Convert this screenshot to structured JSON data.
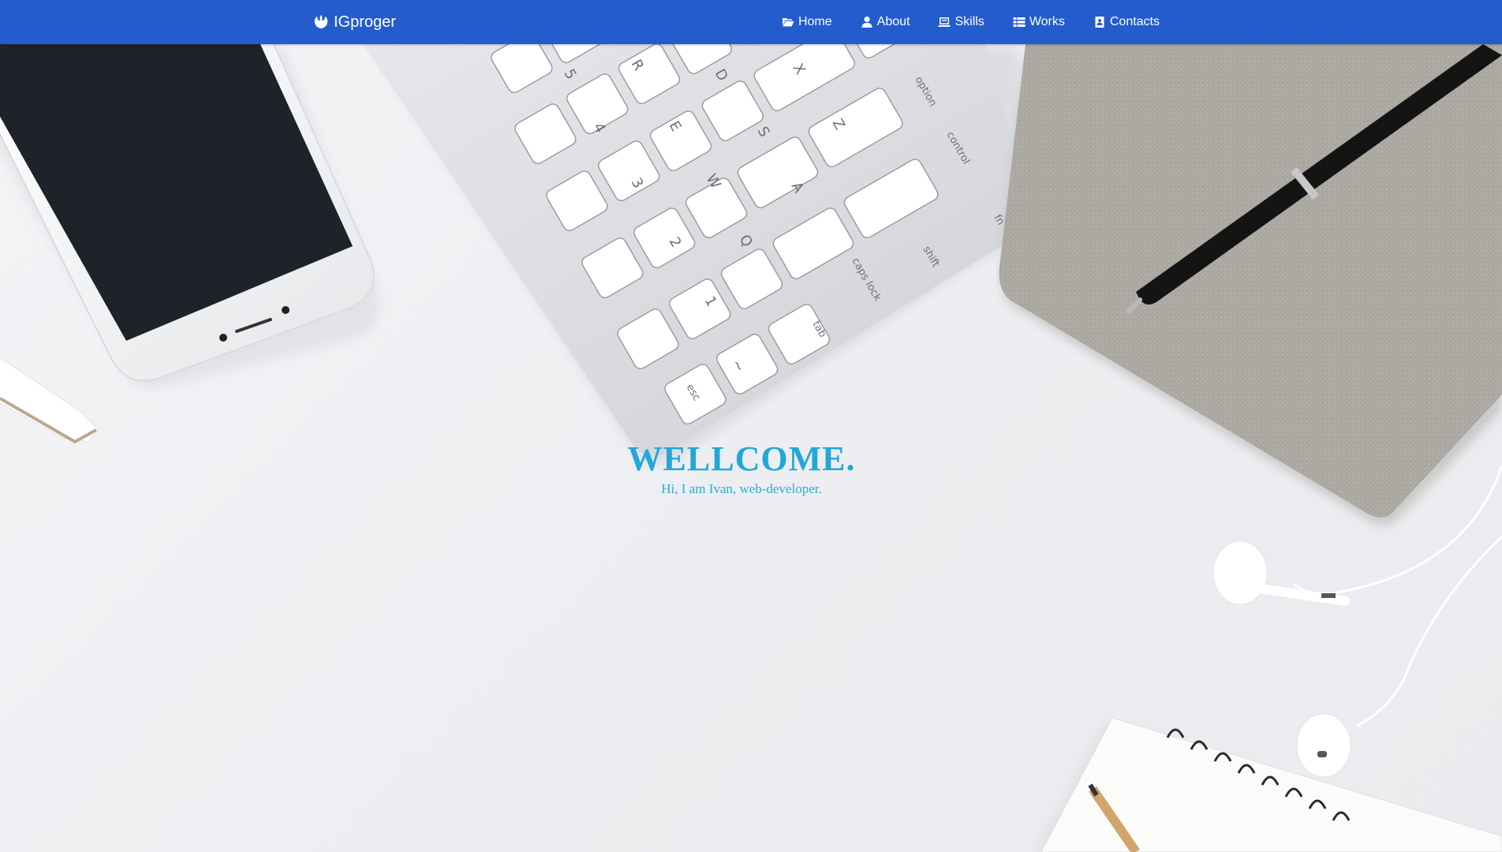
{
  "navbar": {
    "brand": "IGproger",
    "brand_icon": "jedi-order-icon",
    "background_color": "#245cce",
    "items": [
      {
        "label": "Home",
        "icon": "folder-open-icon"
      },
      {
        "label": "About",
        "icon": "user-icon"
      },
      {
        "label": "Skills",
        "icon": "laptop-icon"
      },
      {
        "label": "Works",
        "icon": "table-icon"
      },
      {
        "label": "Contacts",
        "icon": "address-book-icon"
      }
    ]
  },
  "hero": {
    "title": "WELLCOME.",
    "subtitle": "Hi, I am Ivan, web-developer.",
    "text_color": "#22a7d8"
  },
  "background": {
    "keyboard_keys": [
      "5",
      "R",
      "D",
      "X",
      "option",
      "4",
      "E",
      "S",
      "Z",
      "control",
      "3",
      "W",
      "A",
      "shift",
      "fn",
      "2",
      "Q",
      "caps lock",
      "1",
      "tab",
      "~",
      "esc"
    ]
  }
}
